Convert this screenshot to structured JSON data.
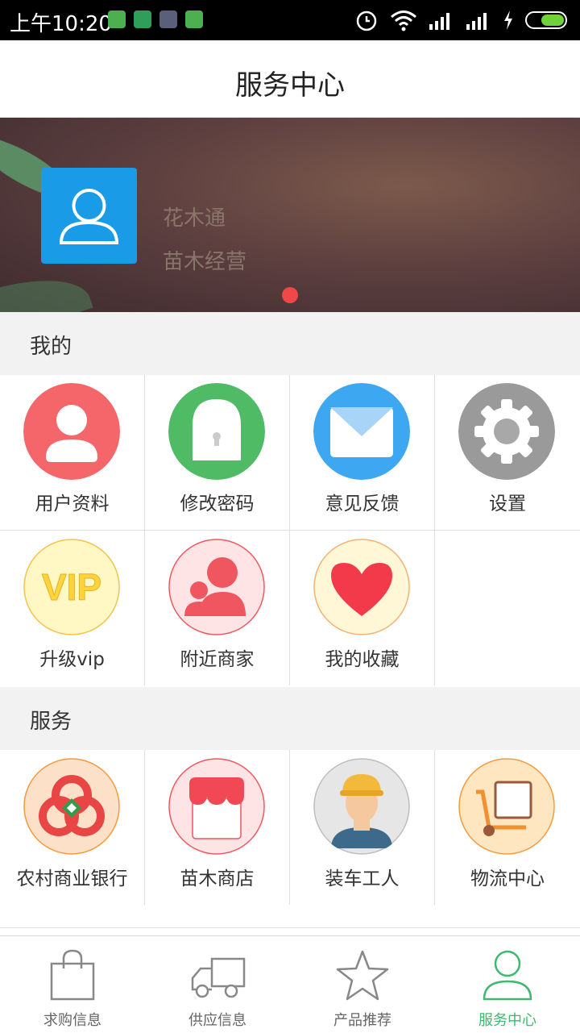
{
  "status_bar": {
    "time": "上午10:20"
  },
  "header": {
    "title": "服务中心"
  },
  "banner": {
    "line1": "花木通",
    "line2": "苗木经营"
  },
  "sections": {
    "mine": {
      "title": "我的"
    },
    "service": {
      "title": "服务"
    }
  },
  "mine_items": [
    {
      "label": "用户资料",
      "icon": "user-icon",
      "color": "#f4666a"
    },
    {
      "label": "修改密码",
      "icon": "lock-icon",
      "color": "#4fbb65"
    },
    {
      "label": "意见反馈",
      "icon": "mail-icon",
      "color": "#3ea7f1"
    },
    {
      "label": "设置",
      "icon": "gear-icon",
      "color": "#9a9a9a"
    },
    {
      "label": "升级vip",
      "icon": "vip-icon",
      "color": "#fff7c4"
    },
    {
      "label": "附近商家",
      "icon": "people-icon",
      "color": "#ffe4e6"
    },
    {
      "label": "我的收藏",
      "icon": "heart-icon",
      "color": "#fff7d6"
    }
  ],
  "service_items": [
    {
      "label": "农村商业银行",
      "icon": "bank-icon",
      "color": "#fde0c8"
    },
    {
      "label": "苗木商店",
      "icon": "shop-icon",
      "color": "#ffe4e6"
    },
    {
      "label": "装车工人",
      "icon": "worker-icon",
      "color": "#e4e4e4"
    },
    {
      "label": "物流中心",
      "icon": "logistics-icon",
      "color": "#fde6c0"
    }
  ],
  "tabs": [
    {
      "label": "求购信息",
      "icon": "bag-icon"
    },
    {
      "label": "供应信息",
      "icon": "truck-icon"
    },
    {
      "label": "产品推荐",
      "icon": "star-icon"
    },
    {
      "label": "服务中心",
      "icon": "person-icon",
      "active": true
    }
  ],
  "colors": {
    "accent": "#3fb870",
    "banner_dot": "#f04848",
    "avatar_bg": "#1a9be8"
  }
}
